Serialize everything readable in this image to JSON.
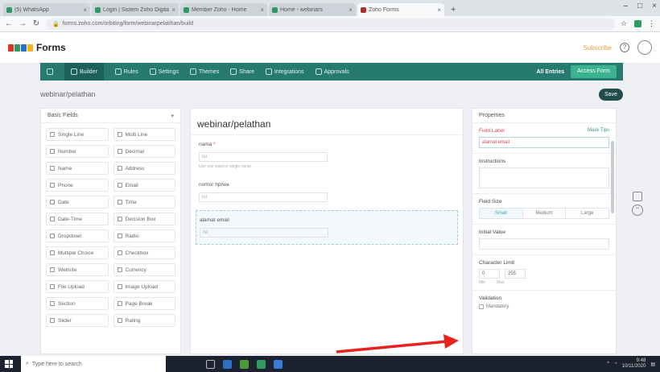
{
  "browser": {
    "tabs": [
      {
        "title": "(5) WhatsApp",
        "favicon": "green"
      },
      {
        "title": "Login | Sistem Zoho Digital",
        "favicon": "green"
      },
      {
        "title": "Member Zoho - Home",
        "favicon": "green"
      },
      {
        "title": "Home - webinars",
        "favicon": "green"
      },
      {
        "title": "Zoho Forms",
        "favicon": "zoho",
        "active": true
      }
    ],
    "url": "forms.zoho.com/orbiting/form/webinarpelatihan/build",
    "window_controls": [
      "–",
      "□",
      "×"
    ]
  },
  "app": {
    "logo_text": "Forms",
    "logo_colors": [
      "#d8362d",
      "#2e9a62",
      "#2f6fc2",
      "#f2b51d"
    ],
    "upgrade_label": "Subscribe"
  },
  "toolbar": {
    "items": [
      {
        "label": "Builder",
        "active": true
      },
      {
        "label": "Rules"
      },
      {
        "label": "Settings"
      },
      {
        "label": "Themes"
      },
      {
        "label": "Share"
      },
      {
        "label": "Integrations"
      },
      {
        "label": "Approvals"
      }
    ],
    "all_entries": "All Entries",
    "access_form": "Access Form"
  },
  "form": {
    "title": "webinar/pelathan",
    "save_label": "Save"
  },
  "left_panel": {
    "header": "Basic Fields",
    "fields": [
      "Single Line",
      "Multi Line",
      "Number",
      "Decimal",
      "Name",
      "Address",
      "Phone",
      "Email",
      "Date",
      "Time",
      "Date-Time",
      "Decision Box",
      "Dropdown",
      "Radio",
      "Multiple Choice",
      "Checkbox",
      "Website",
      "Currency",
      "File Upload",
      "Image Upload",
      "Section",
      "Page Break",
      "Slider",
      "Rating"
    ]
  },
  "canvas": {
    "heading": "webinar/pelathan",
    "fields": [
      {
        "label": "nama",
        "required": true,
        "value": "Isi",
        "hint": "Use one word or single name"
      },
      {
        "label": "nomor hp/wa",
        "required": false,
        "value": "Isi",
        "hint": ""
      },
      {
        "label": "alamat email",
        "required": false,
        "value": "Isi",
        "hint": "",
        "selected": true
      }
    ]
  },
  "properties": {
    "header": "Properties",
    "field_label": "Field Label",
    "field_label_link": "Mask Tips",
    "field_label_value": "alamat email",
    "instructions": "Instructions",
    "field_size": "Field Size",
    "sizes": [
      "Small",
      "Medium",
      "Large"
    ],
    "selected_size": "Small",
    "initial_value": "Initial Value",
    "character_limit": "Character Limit",
    "char_min": "0",
    "char_max": "255",
    "char_min_label": "Min",
    "char_max_label": "Max",
    "validation": "Validation",
    "mandatory": "Mandatory"
  },
  "taskbar": {
    "search_placeholder": "Type here to search",
    "clock_time": "9:48",
    "clock_date": "10/11/2020"
  }
}
